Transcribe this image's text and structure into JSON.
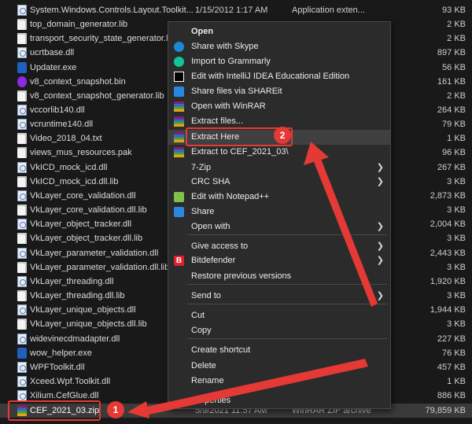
{
  "files": [
    {
      "name": "System.Windows.Controls.Layout.Toolkit...",
      "date": "1/15/2012 1:17 AM",
      "type": "Application exten...",
      "size": "93 KB",
      "icon": "dll"
    },
    {
      "name": "top_domain_generator.lib",
      "date": "",
      "type": "",
      "size": "2 KB",
      "icon": "doc"
    },
    {
      "name": "transport_security_state_generator.lib",
      "date": "",
      "type": "",
      "size": "2 KB",
      "icon": "doc"
    },
    {
      "name": "ucrtbase.dll",
      "date": "",
      "type": "",
      "size": "897 KB",
      "icon": "dll"
    },
    {
      "name": "Updater.exe",
      "date": "",
      "type": "",
      "size": "56 KB",
      "icon": "exe"
    },
    {
      "name": "v8_context_snapshot.bin",
      "date": "",
      "type": "",
      "size": "161 KB",
      "icon": "bin"
    },
    {
      "name": "v8_context_snapshot_generator.lib",
      "date": "",
      "type": "",
      "size": "2 KB",
      "icon": "doc"
    },
    {
      "name": "vccorlib140.dll",
      "date": "",
      "type": "",
      "size": "264 KB",
      "icon": "dll"
    },
    {
      "name": "vcruntime140.dll",
      "date": "",
      "type": "",
      "size": "79 KB",
      "icon": "dll"
    },
    {
      "name": "Video_2018_04.txt",
      "date": "",
      "type": "",
      "size": "1 KB",
      "icon": "doc"
    },
    {
      "name": "views_mus_resources.pak",
      "date": "",
      "type": "",
      "size": "96 KB",
      "icon": "doc"
    },
    {
      "name": "VkICD_mock_icd.dll",
      "date": "",
      "type": "",
      "size": "267 KB",
      "icon": "dll"
    },
    {
      "name": "VkICD_mock_icd.dll.lib",
      "date": "",
      "type": "",
      "size": "3 KB",
      "icon": "doc"
    },
    {
      "name": "VkLayer_core_validation.dll",
      "date": "",
      "type": "",
      "size": "2,873 KB",
      "icon": "dll"
    },
    {
      "name": "VkLayer_core_validation.dll.lib",
      "date": "",
      "type": "",
      "size": "3 KB",
      "icon": "doc"
    },
    {
      "name": "VkLayer_object_tracker.dll",
      "date": "",
      "type": "",
      "size": "2,004 KB",
      "icon": "dll"
    },
    {
      "name": "VkLayer_object_tracker.dll.lib",
      "date": "",
      "type": "",
      "size": "3 KB",
      "icon": "doc"
    },
    {
      "name": "VkLayer_parameter_validation.dll",
      "date": "",
      "type": "",
      "size": "2,443 KB",
      "icon": "dll"
    },
    {
      "name": "VkLayer_parameter_validation.dll.lib",
      "date": "",
      "type": "",
      "size": "3 KB",
      "icon": "doc"
    },
    {
      "name": "VkLayer_threading.dll",
      "date": "",
      "type": "",
      "size": "1,920 KB",
      "icon": "dll"
    },
    {
      "name": "VkLayer_threading.dll.lib",
      "date": "",
      "type": "",
      "size": "3 KB",
      "icon": "doc"
    },
    {
      "name": "VkLayer_unique_objects.dll",
      "date": "",
      "type": "",
      "size": "1,944 KB",
      "icon": "dll"
    },
    {
      "name": "VkLayer_unique_objects.dll.lib",
      "date": "",
      "type": "",
      "size": "3 KB",
      "icon": "doc"
    },
    {
      "name": "widevinecdmadapter.dll",
      "date": "",
      "type": "",
      "size": "227 KB",
      "icon": "dll"
    },
    {
      "name": "wow_helper.exe",
      "date": "",
      "type": "",
      "size": "76 KB",
      "icon": "exe"
    },
    {
      "name": "WPFToolkit.dll",
      "date": "",
      "type": "",
      "size": "457 KB",
      "icon": "dll"
    },
    {
      "name": "Xceed.Wpf.Toolkit.dll",
      "date": "",
      "type": "",
      "size": "1 KB",
      "icon": "dll"
    },
    {
      "name": "Xilium.CefGlue.dll",
      "date": "",
      "type": "",
      "size": "886 KB",
      "icon": "dll"
    },
    {
      "name": "CEF_2021_03.zip",
      "date": "5/9/2021 11:57 AM",
      "type": "WinRAR ZIP archive",
      "size": "79,859 KB",
      "icon": "rar"
    }
  ],
  "menu": [
    {
      "label": "Open",
      "bold": true,
      "icon": "",
      "submenu": false
    },
    {
      "label": "Share with Skype",
      "icon": "skype-icon",
      "submenu": false
    },
    {
      "label": "Import to Grammarly",
      "icon": "grammarly-icon",
      "submenu": false
    },
    {
      "label": "Edit with IntelliJ IDEA Educational Edition",
      "icon": "intellij-icon",
      "submenu": false
    },
    {
      "label": "Share files via SHAREit",
      "icon": "shareit-icon",
      "submenu": false
    },
    {
      "label": "Open with WinRAR",
      "icon": "winrar-icon",
      "submenu": false
    },
    {
      "label": "Extract files...",
      "icon": "winrar-icon",
      "submenu": false
    },
    {
      "label": "Extract Here",
      "icon": "winrar-icon",
      "submenu": false
    },
    {
      "label": "Extract to CEF_2021_03\\",
      "icon": "winrar-icon",
      "submenu": false
    },
    {
      "label": "7-Zip",
      "icon": "",
      "submenu": true
    },
    {
      "label": "CRC SHA",
      "icon": "",
      "submenu": true
    },
    {
      "label": "Edit with Notepad++",
      "icon": "notepadpp-icon",
      "submenu": false
    },
    {
      "label": "Share",
      "icon": "share-icon",
      "submenu": false
    },
    {
      "label": "Open with",
      "icon": "",
      "submenu": true
    },
    {
      "label": "Give access to",
      "icon": "",
      "submenu": true
    },
    {
      "label": "Bitdefender",
      "icon": "bitdefender-icon",
      "submenu": true
    },
    {
      "label": "Restore previous versions",
      "icon": "",
      "submenu": false
    },
    {
      "label": "Send to",
      "icon": "",
      "submenu": true
    },
    {
      "label": "Cut",
      "icon": "",
      "submenu": false
    },
    {
      "label": "Copy",
      "icon": "",
      "submenu": false
    },
    {
      "label": "Create shortcut",
      "icon": "",
      "submenu": false
    },
    {
      "label": "Delete",
      "icon": "",
      "submenu": false
    },
    {
      "label": "Rename",
      "icon": "",
      "submenu": false
    },
    {
      "label": "Properties",
      "icon": "",
      "submenu": false
    }
  ],
  "annotations": {
    "step1": "1",
    "step2": "2"
  },
  "colors": {
    "highlight": "#e53935",
    "menu_bg": "#2b2b2b",
    "list_bg": "#191919"
  }
}
